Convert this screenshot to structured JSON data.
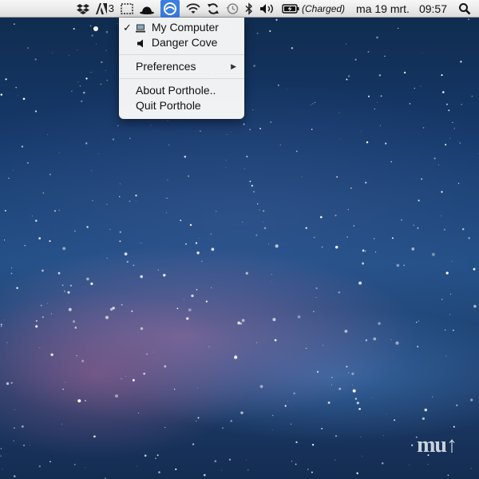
{
  "menubar": {
    "notifications_count": "3",
    "battery_status": "(Charged)",
    "date": "ma 19 mrt.",
    "time": "09:57",
    "icons": [
      "dropbox-icon",
      "adobe-icon",
      "screenshot-selection-icon",
      "bowler-hat-icon",
      "porthole-icon",
      "wifi-icon",
      "sync-icon",
      "time-machine-icon",
      "bluetooth-icon",
      "volume-icon",
      "battery-icon",
      "spotlight-icon"
    ]
  },
  "porthole_menu": {
    "devices": [
      {
        "label": "My Computer",
        "checked": true,
        "icon": "computer-icon"
      },
      {
        "label": "Danger Cove",
        "checked": false,
        "icon": "speaker-icon"
      }
    ],
    "preferences_label": "Preferences",
    "about_label": "About Porthole..",
    "quit_label": "Quit Porthole"
  },
  "desktop": {
    "accent_color": "#3b7de0",
    "watermark_logo": "mu"
  }
}
